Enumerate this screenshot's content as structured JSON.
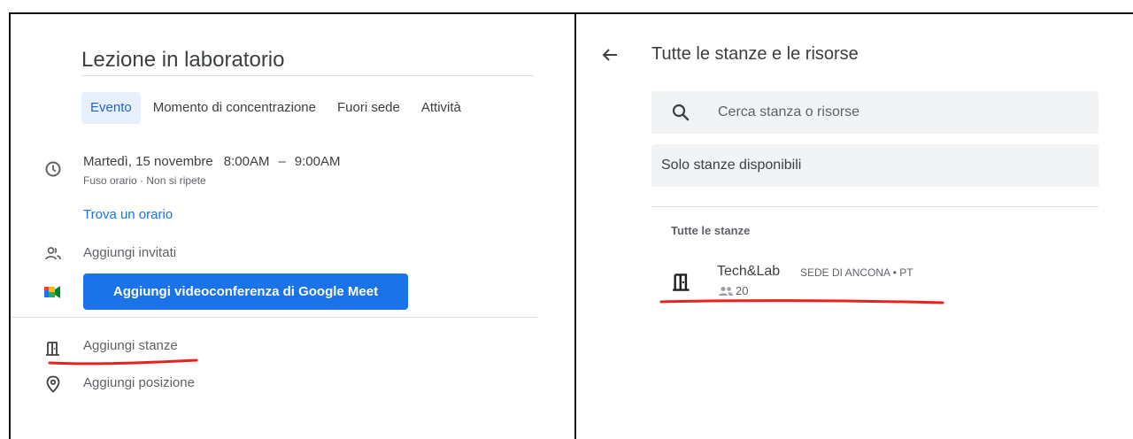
{
  "left": {
    "title": "Lezione in laboratorio",
    "tabs": [
      {
        "label": "Evento",
        "active": true
      },
      {
        "label": "Momento di concentrazione",
        "active": false
      },
      {
        "label": "Fuori sede",
        "active": false
      },
      {
        "label": "Attività",
        "active": false
      }
    ],
    "date": "Martedì, 15 novembre",
    "start": "8:00AM",
    "dash": "–",
    "end": "9:00AM",
    "timezone_line": "Fuso orario · Non si ripete",
    "find_time": "Trova un orario",
    "add_guests": "Aggiungi invitati",
    "meet_button": "Aggiungi videoconferenza di Google Meet",
    "add_rooms": "Aggiungi stanze",
    "add_location": "Aggiungi posizione"
  },
  "right": {
    "title": "Tutte le stanze e le risorse",
    "search_placeholder": "Cerca stanza o risorse",
    "filter_label": "Solo stanze disponibili",
    "section_label": "Tutte le stanze",
    "room": {
      "name": "Tech&Lab",
      "location": "SEDE DI ANCONA • PT",
      "capacity": "20"
    }
  },
  "colors": {
    "accent": "#1a73e8",
    "tab_active_bg": "#e8f0fe",
    "annotation_red": "#e8231f",
    "field_bg": "#f1f3f4"
  },
  "icons": [
    "clock-icon",
    "people-icon",
    "google-meet-icon",
    "room-door-icon",
    "location-pin-icon",
    "back-arrow-icon",
    "search-icon",
    "capacity-people-icon"
  ]
}
